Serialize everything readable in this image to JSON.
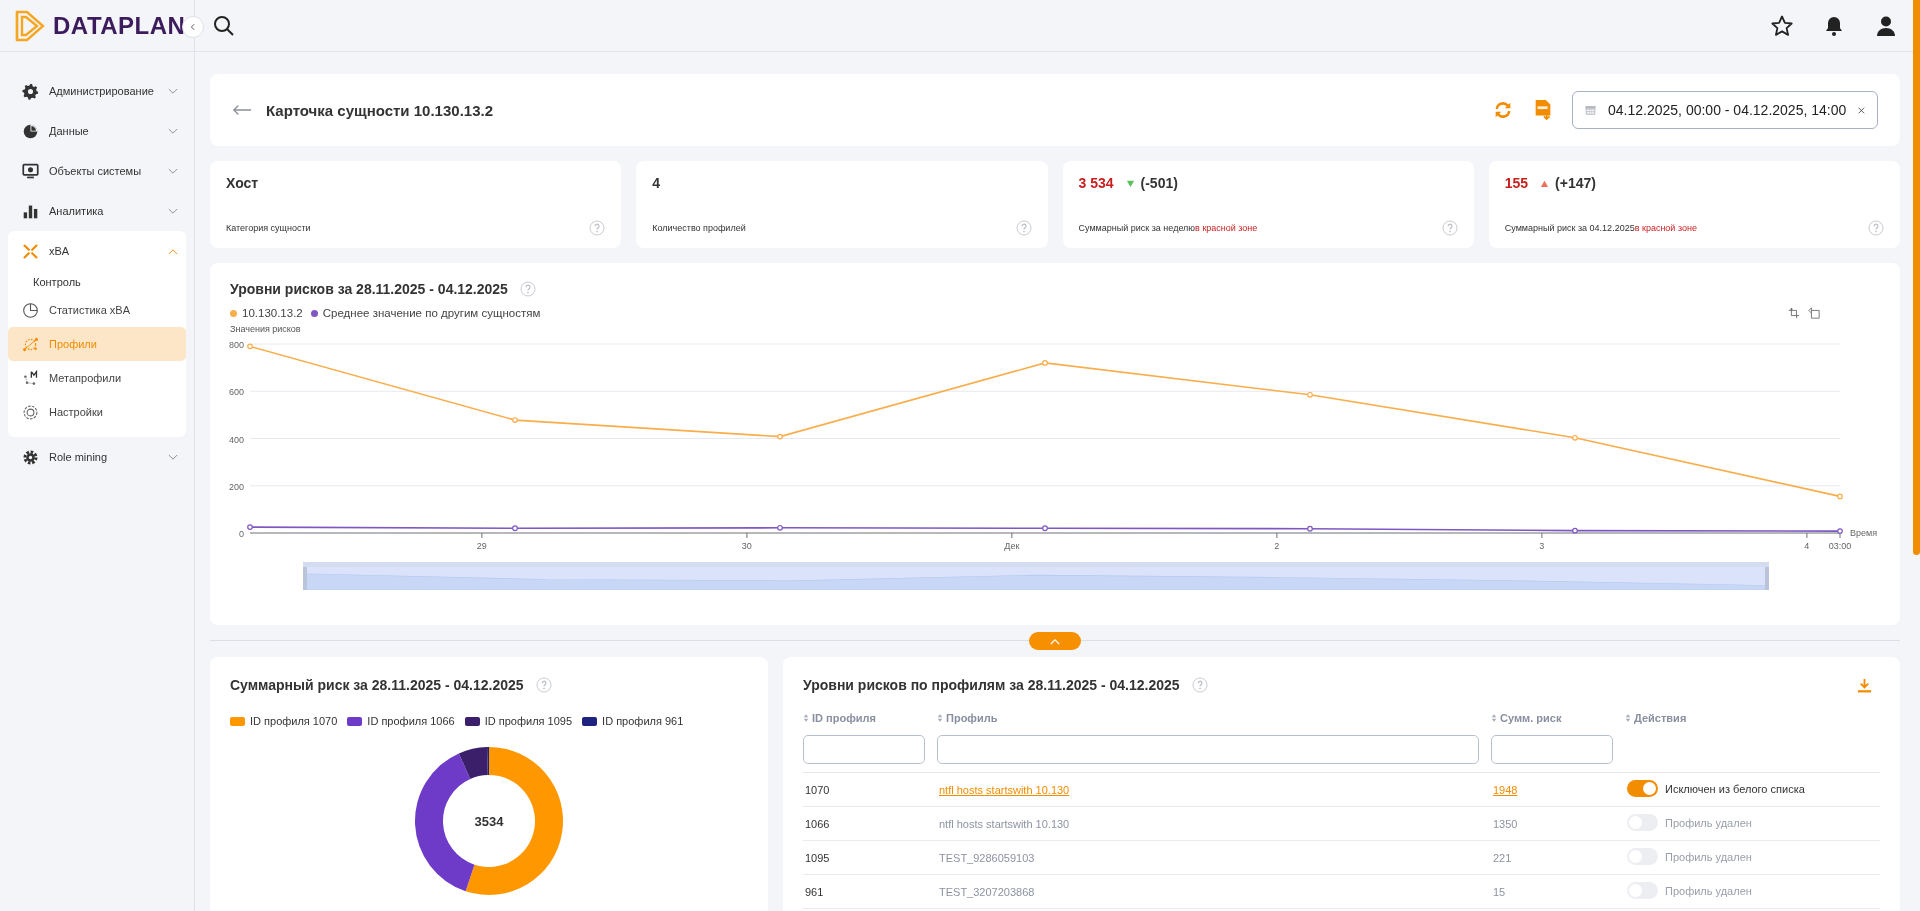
{
  "sidebar": {
    "logo": "DATAPLAN",
    "items": [
      {
        "label": "Администрирование",
        "expanded": false
      },
      {
        "label": "Данные",
        "expanded": false
      },
      {
        "label": "Объекты системы",
        "expanded": false
      },
      {
        "label": "Аналитика",
        "expanded": false
      },
      {
        "label": "xBA",
        "expanded": true,
        "children": [
          {
            "label": "Контроль",
            "kind": "label",
            "selected": false
          },
          {
            "label": "Статистика xBA",
            "kind": "link",
            "selected": false
          },
          {
            "label": "Профили",
            "kind": "link",
            "selected": true
          },
          {
            "label": "Метапрофили",
            "kind": "link",
            "selected": false
          },
          {
            "label": "Настройки",
            "kind": "link",
            "selected": false
          }
        ]
      },
      {
        "label": "Role mining",
        "expanded": false
      }
    ]
  },
  "header": {
    "title": "Карточка сущности 10.130.13.2",
    "date_range": "04.12.2025, 00:00 - 04.12.2025, 14:00"
  },
  "stats": [
    {
      "kind": "plain",
      "value": "Хост",
      "label": "Категория сущности"
    },
    {
      "kind": "plain",
      "value": "4",
      "label": "Количество профилей"
    },
    {
      "kind": "risk",
      "value": "3 534",
      "rising": false,
      "delta": "(-501)",
      "label": "Суммарный риск за неделю",
      "label_highlight": "в красной зоне"
    },
    {
      "kind": "risk",
      "value": "155",
      "rising": true,
      "delta": "(+147)",
      "label": "Суммарный риск за 04.12.2025",
      "label_highlight": "в красной зоне"
    }
  ],
  "risk_chart": {
    "title": "Уровни рисков за 28.11.2025 - 04.12.2025",
    "chart_data": {
      "type": "line",
      "grid": true,
      "xlabel": "Время",
      "ylabel": "Значения рисков",
      "x": [
        "2025-11-28T03:00",
        "2025-11-29T03:00",
        "2025-11-30T03:00",
        "2025-12-01T03:00",
        "2025-12-02T03:00",
        "2025-12-03T03:00",
        "2025-12-04T03:00"
      ],
      "series": [
        {
          "name": "10.130.13.2",
          "color": "#f9ad4b",
          "marker": "circle",
          "values": [
            790,
            478,
            408,
            720,
            585,
            403,
            155
          ]
        },
        {
          "name": "Среднее значение по другим сущностям",
          "color": "#7e57c2",
          "marker": "circle",
          "values": [
            25,
            20,
            22,
            20,
            18,
            10,
            8
          ]
        }
      ],
      "xlim": [
        "2025-11-28T03:00",
        "2025-12-04T03:00"
      ],
      "ylim": [
        0,
        800
      ],
      "yticks": [
        0,
        200,
        400,
        600,
        800
      ],
      "xticks": [
        {
          "value": "2025-11-29T00:00",
          "label": "29"
        },
        {
          "value": "2025-11-30T00:00",
          "label": "30"
        },
        {
          "value": "2025-12-01T00:00",
          "label": "Дек"
        },
        {
          "value": "2025-12-02T00:00",
          "label": "2"
        },
        {
          "value": "2025-12-03T00:00",
          "label": "3"
        },
        {
          "value": "2025-12-04T00:00",
          "label": "4"
        },
        {
          "value": "2025-12-04T03:00",
          "label": "03:00"
        }
      ]
    },
    "range_slider": {
      "level": 1
    }
  },
  "summary_panel": {
    "title": "Суммарный риск за 28.11.2025 - 04.12.2025",
    "legend": [
      {
        "color": "#ff9800"
      },
      {
        "color": "#6d3bc8"
      },
      {
        "color": "#3b1f6b"
      },
      {
        "color": "#1f2380"
      }
    ],
    "chart_data": {
      "type": "donut",
      "categories": [
        "ID профиля 1070",
        "ID профиля 1066",
        "ID профиля 1095",
        "ID профиля 961"
      ],
      "values": [
        55.12,
        38.2,
        6.26,
        0.42
      ]
    },
    "center_label": "3534"
  },
  "profiles_table": {
    "title": "Уровни рисков по профилям за 28.11.2025 - 04.12.2025",
    "columns": [
      {
        "label": "ID профиля",
        "filter": true
      },
      {
        "label": "Профиль",
        "filter": true
      },
      {
        "label": "Сумм. риск",
        "filter": true
      },
      {
        "label": "Действия",
        "filter": false
      }
    ],
    "rows": [
      {
        "id": "1070",
        "profile": "ntfl hosts startswith 10.130",
        "risk": "1948",
        "action": "Исключен из белого списка",
        "disabled": false,
        "on": true
      },
      {
        "id": "1066",
        "profile": "ntfl hosts startswith 10.130",
        "risk": "1350",
        "action": "Профиль удален",
        "disabled": true,
        "on": false
      },
      {
        "id": "1095",
        "profile": "TEST_9286059103",
        "risk": "221",
        "action": "Профиль удален",
        "disabled": true,
        "on": false
      },
      {
        "id": "961",
        "profile": "TEST_3207203868",
        "risk": "15",
        "action": "Профиль удален",
        "disabled": true,
        "on": false
      }
    ]
  }
}
